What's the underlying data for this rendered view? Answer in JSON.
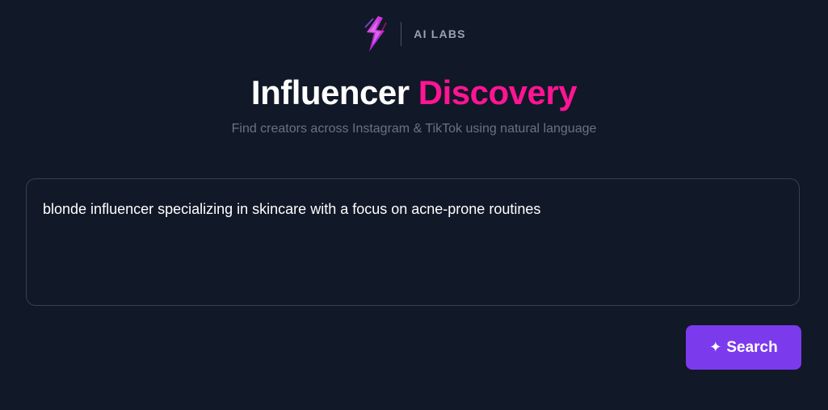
{
  "brand": {
    "name": "AI LABS",
    "logo_icon": "lightning-bolt-icon",
    "logo_colors": [
      "#c026d3",
      "#7c3aed",
      "#ff1493"
    ]
  },
  "header": {
    "title_main": "Influencer",
    "title_accent": "Discovery",
    "subtitle": "Find creators across Instagram & TikTok using natural language"
  },
  "search": {
    "query": "blonde influencer specializing in skincare with a focus on acne-prone routines",
    "button_icon_glyph": "✦",
    "button_label": "Search"
  },
  "colors": {
    "background": "#111827",
    "accent_pink": "#ff1493",
    "button_purple": "#7c3aed",
    "subtitle_gray": "#6b7280"
  }
}
